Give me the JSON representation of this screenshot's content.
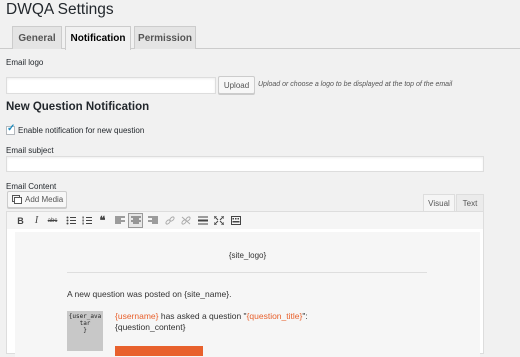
{
  "page": {
    "title": "DWQA Settings"
  },
  "tabs": [
    {
      "label": "General",
      "active": false
    },
    {
      "label": "Notification",
      "active": true
    },
    {
      "label": "Permission",
      "active": false
    }
  ],
  "email_logo": {
    "label": "Email logo",
    "value": "",
    "upload_button": "Upload",
    "hint": "Upload or choose a logo to be displayed at the top of the email"
  },
  "new_question": {
    "section_title": "New Question Notification",
    "enable_checkbox": {
      "label": "Enable notification for new question",
      "checked": true
    },
    "subject": {
      "label": "Email subject",
      "value": ""
    },
    "content": {
      "label": "Email Content",
      "add_media_button": "Add Media",
      "editor_tabs": [
        {
          "label": "Visual",
          "active": true
        },
        {
          "label": "Text",
          "active": false
        }
      ],
      "toolbar_icons": [
        "bold-icon",
        "italic-icon",
        "strikethrough-icon",
        "bulleted-list-icon",
        "numbered-list-icon",
        "blockquote-icon",
        "align-left-icon",
        "align-center-icon",
        "align-right-icon",
        "insert-link-icon",
        "remove-link-icon",
        "horizontal-line-icon",
        "fullscreen-icon",
        "toolbar-toggle-icon"
      ],
      "body": {
        "site_logo": "{site_logo}",
        "intro": "A new question was posted on {site_name}.",
        "avatar_placeholder": "{user_avatar}",
        "username": "{username}",
        "asked_text": " has asked a question \"",
        "question_title": "{question_title}",
        "closing_text": "\":",
        "question_content": "{question_content}"
      }
    }
  },
  "colors": {
    "accent_orange": "#e8612d",
    "background": "#f1f1f1",
    "checkbox_check": "#1e8cbe"
  }
}
